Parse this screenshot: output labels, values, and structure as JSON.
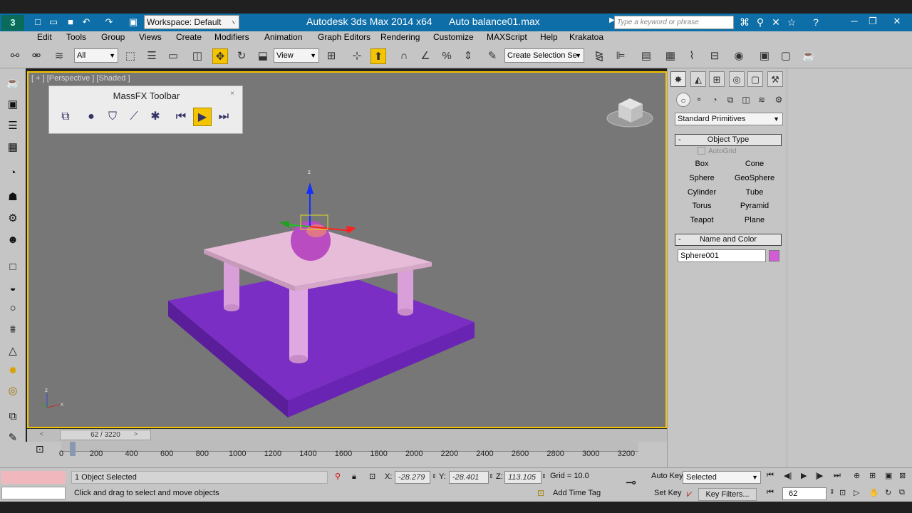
{
  "titlebar": {
    "logo": "3",
    "workspace": "Workspace: Default",
    "app_title": "Autodesk 3ds Max  2014 x64",
    "file_title": "Auto balance01.max",
    "search_placeholder": "Type a keyword or phrase"
  },
  "menu": [
    "Edit",
    "Tools",
    "Group",
    "Views",
    "Create",
    "Modifiers",
    "Animation",
    "Graph Editors",
    "Rendering",
    "Customize",
    "MAXScript",
    "Help",
    "Krakatoa"
  ],
  "toolbar": {
    "filter": "All",
    "ref_coord": "View",
    "named_selection": "Create Selection Se"
  },
  "viewport": {
    "label": "[ + ] [Perspective ] [Shaded ]",
    "massfx_title": "MassFX Toolbar",
    "close": "×",
    "gizmo_z": "z",
    "axis_z": "z",
    "axis_x": "x"
  },
  "command_panel": {
    "category": "Standard Primitives",
    "object_type_title": "Object Type",
    "autogrid": "AutoGrid",
    "buttons": [
      "Box",
      "Cone",
      "Sphere",
      "GeoSphere",
      "Cylinder",
      "Tube",
      "Torus",
      "Pyramid",
      "Teapot",
      "Plane"
    ],
    "name_color_title": "Name and Color",
    "object_name": "Sphere001",
    "object_color": "#d25cd6",
    "rollout_minus": "-"
  },
  "time_slider": {
    "label": "62 / 3220"
  },
  "track_ticks": [
    "0",
    "200",
    "400",
    "600",
    "800",
    "1000",
    "1200",
    "1400",
    "1600",
    "1800",
    "2000",
    "2200",
    "2400",
    "2600",
    "2800",
    "3000",
    "3200"
  ],
  "status": {
    "selected": "1 Object Selected",
    "prompt": "Click and drag to select and move objects",
    "x_label": "X:",
    "x": "-28.279",
    "y_label": "Y:",
    "y": "-28.401",
    "z_label": "Z:",
    "z": "113.105",
    "grid": "Grid = 10.0",
    "add_time_tag": "Add Time Tag",
    "auto_key": "Auto Key",
    "set_key": "Set Key",
    "selected_set": "Selected",
    "key_filters": "Key Filters...",
    "frame": "62"
  }
}
